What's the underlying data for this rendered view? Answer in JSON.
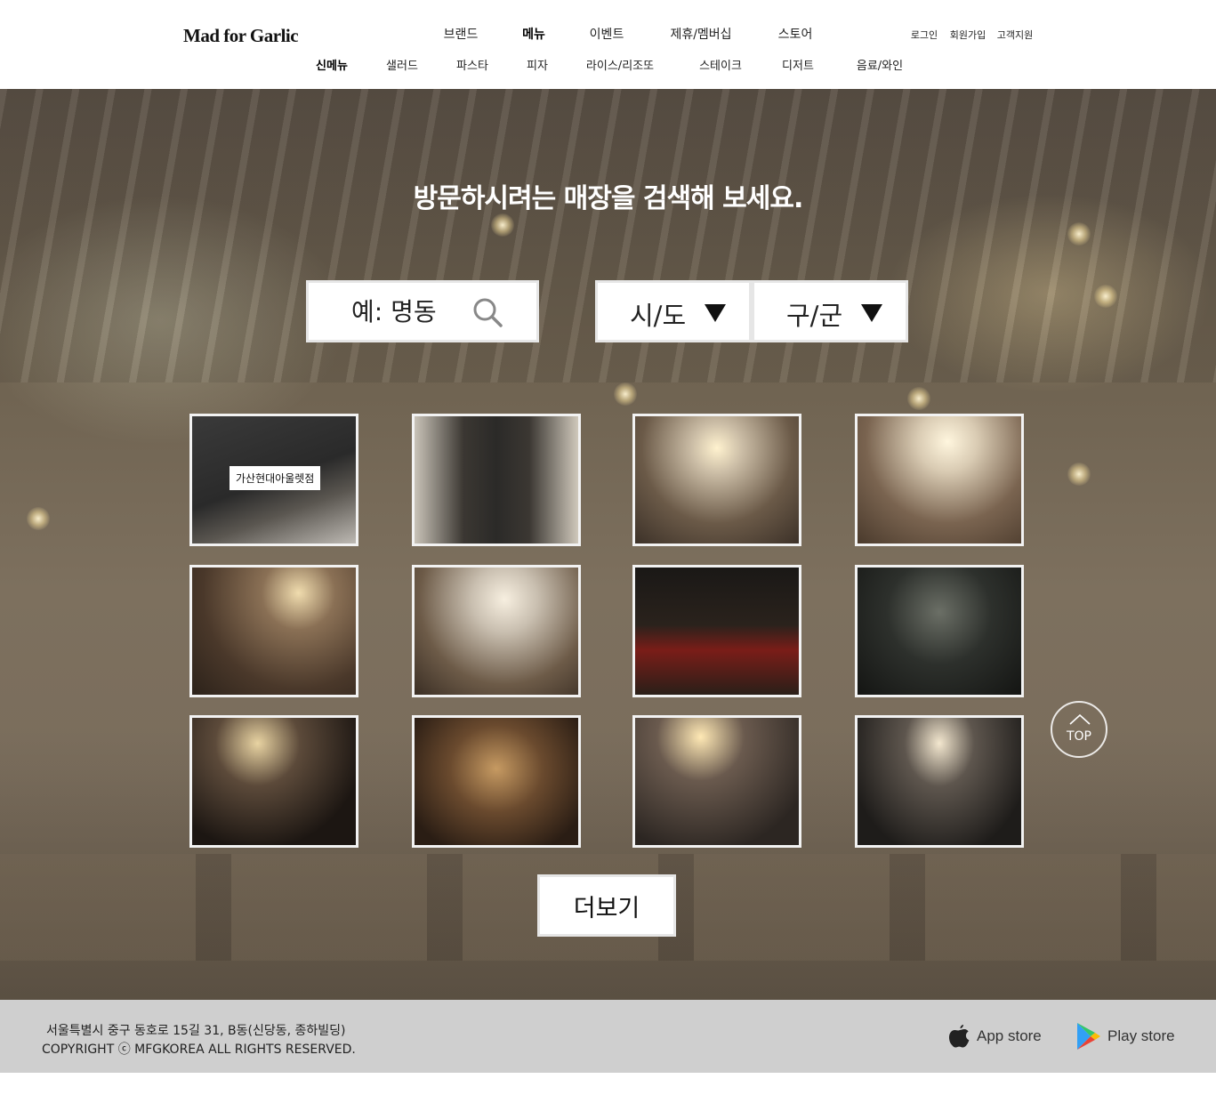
{
  "header": {
    "logo": "Mad for Garlic",
    "main_nav": [
      "브랜드",
      "메뉴",
      "이벤트",
      "제휴/멤버십",
      "스토어"
    ],
    "main_nav_active": "메뉴",
    "util_nav": [
      "로그인",
      "회원가입",
      "고객지원"
    ],
    "sub_nav": [
      "신메뉴",
      "샐러드",
      "파스타",
      "피자",
      "라이스/리조또",
      "스테이크",
      "디저트",
      "음료/와인"
    ],
    "sub_nav_active": "신메뉴"
  },
  "hero": {
    "title": "방문하시려는 매장을 검색해 보세요.",
    "search": {
      "placeholder": "예: 명동",
      "icon": "search-icon"
    },
    "select_city": {
      "label": "시/도",
      "icon": "triangle-down-icon"
    },
    "select_district": {
      "label": "구/군",
      "icon": "triangle-down-icon"
    }
  },
  "stores": [
    {
      "name": "가산현대아울렛점",
      "label_shown": true
    },
    {
      "name": "",
      "label_shown": false
    },
    {
      "name": "",
      "label_shown": false
    },
    {
      "name": "",
      "label_shown": false
    },
    {
      "name": "",
      "label_shown": false
    },
    {
      "name": "",
      "label_shown": false
    },
    {
      "name": "",
      "label_shown": false
    },
    {
      "name": "",
      "label_shown": false
    },
    {
      "name": "",
      "label_shown": false
    },
    {
      "name": "",
      "label_shown": false
    },
    {
      "name": "",
      "label_shown": false
    },
    {
      "name": "",
      "label_shown": false
    }
  ],
  "more_button": "더보기",
  "top_button": "TOP",
  "footer": {
    "address": "서울특별시 중구 동호로 15길 31, B동(신당동, 종하빌딩)",
    "copyright": "COPYRIGHT ⓒ MFGKOREA ALL RIGHTS RESERVED.",
    "app_store": "App store",
    "play_store": "Play store"
  },
  "colors": {
    "header_bg": "#ffffff",
    "footer_bg": "#cfcfcf",
    "hero_overlay": "#7a6d5c",
    "card_border": "#f2f2f2"
  }
}
